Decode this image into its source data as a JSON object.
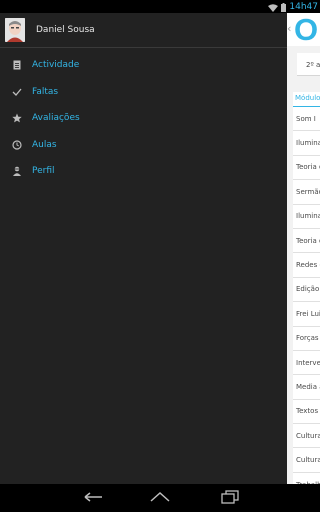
{
  "status_bar": {
    "time": "14h47"
  },
  "drawer": {
    "user_name": "Daniel Sousa",
    "items": [
      {
        "label": "Actividade",
        "icon": "document-icon"
      },
      {
        "label": "Faltas",
        "icon": "checkmark-icon"
      },
      {
        "label": "Avaliações",
        "icon": "star-icon"
      },
      {
        "label": "Aulas",
        "icon": "clock-icon"
      },
      {
        "label": "Perfil",
        "icon": "person-icon"
      }
    ]
  },
  "content": {
    "brand_letter": "O",
    "year_text": "2º a",
    "modules_header": "Módulo",
    "modules": [
      "Som I",
      "Ilumina",
      "Teoria d",
      "Sermão",
      "Ilumina",
      "Teoria d",
      "Redes d",
      "Edição",
      "Frei Lui",
      "Forças",
      "Interve",
      "Media a",
      "Textos",
      "Cultura",
      "Cultura",
      "Trabalh"
    ]
  },
  "colors": {
    "accent": "#33b5e5",
    "drawer_bg": "#222222"
  }
}
